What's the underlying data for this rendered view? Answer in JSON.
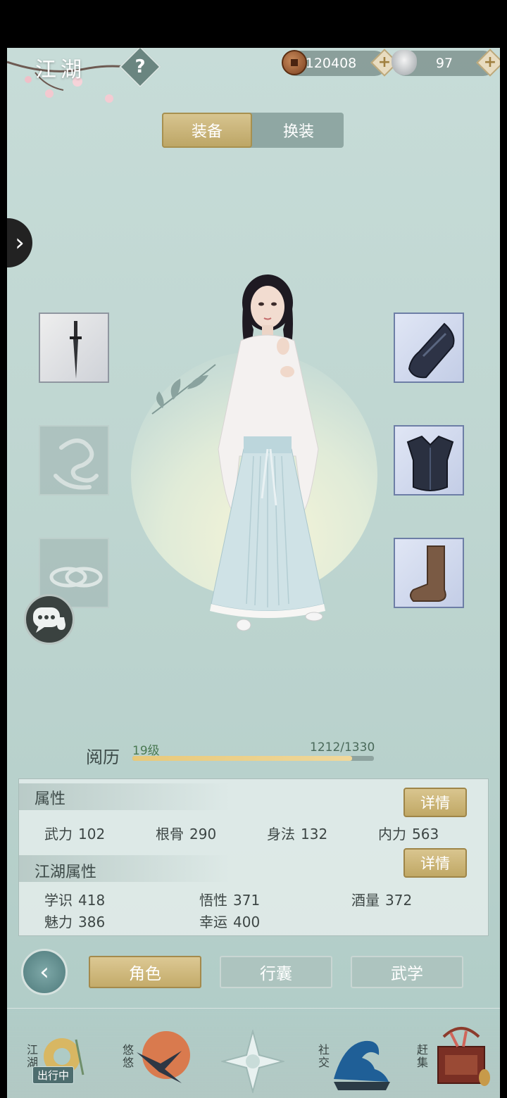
{
  "header": {
    "title": "江湖",
    "help_label": "?",
    "coins": "120408",
    "silver": "97",
    "plus_label": "+"
  },
  "equip_tabs": {
    "active": "装备",
    "other": "换装"
  },
  "side_arrow": "›",
  "experience": {
    "label": "阅历",
    "level": "19级",
    "value": "1212/1330",
    "progress": 0.911
  },
  "attributes": {
    "title": "属性",
    "detail": "详情",
    "items": [
      {
        "name": "武力",
        "value": "102"
      },
      {
        "name": "根骨",
        "value": "290"
      },
      {
        "name": "身法",
        "value": "132"
      },
      {
        "name": "内力",
        "value": "563"
      }
    ]
  },
  "jianghu_attributes": {
    "title": "江湖属性",
    "detail": "详情",
    "items": [
      {
        "name": "学识",
        "value": "418"
      },
      {
        "name": "悟性",
        "value": "371"
      },
      {
        "name": "酒量",
        "value": "372"
      },
      {
        "name": "魅力",
        "value": "386"
      },
      {
        "name": "幸运",
        "value": "400"
      }
    ]
  },
  "bottom_tabs": [
    "角色",
    "行囊",
    "武学"
  ],
  "nav": {
    "jianghu": "江湖",
    "jianghu_status": "出行中",
    "youyou": "悠悠",
    "social": "社交",
    "market": "赶集"
  },
  "slots": {
    "left": [
      "weapon-dagger",
      "talisman-empty",
      "ring-empty"
    ],
    "right": [
      "armguard",
      "chest-armor",
      "boots"
    ]
  }
}
